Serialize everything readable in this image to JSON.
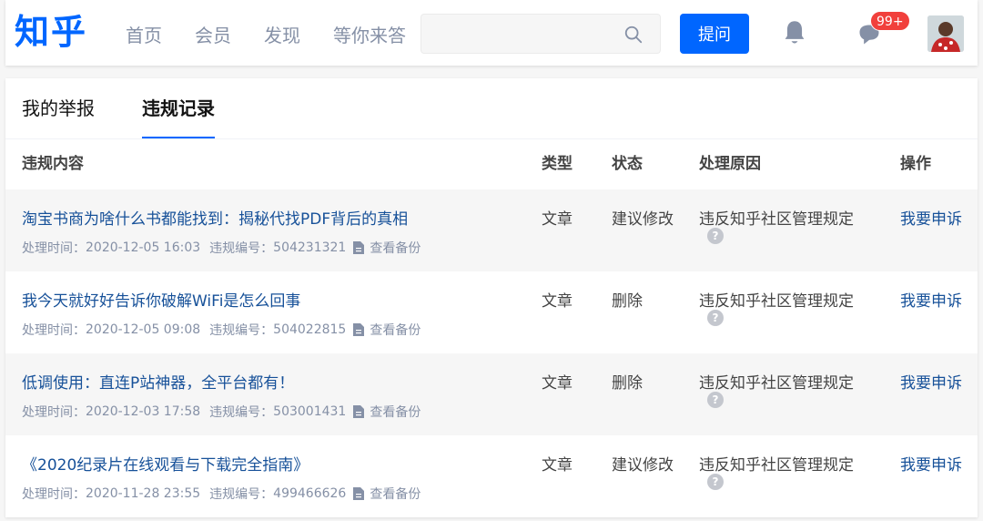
{
  "header": {
    "logo": "知乎",
    "nav": [
      "首页",
      "会员",
      "发现",
      "等你来答"
    ],
    "search_placeholder": "",
    "ask_button": "提问",
    "notification_badge": "99+"
  },
  "tabs": [
    {
      "label": "我的举报",
      "active": false
    },
    {
      "label": "违规记录",
      "active": true
    }
  ],
  "table": {
    "columns": [
      "违规内容",
      "类型",
      "状态",
      "处理原因",
      "操作"
    ],
    "meta_labels": {
      "time_prefix": "处理时间：",
      "id_prefix": "违规编号：",
      "backup": "查看备份"
    },
    "rows": [
      {
        "title": "淘宝书商为啥什么书都能找到：揭秘代找PDF背后的真相",
        "time": "2020-12-05 16:03",
        "id": "504231321",
        "type": "文章",
        "status": "建议修改",
        "reason": "违反知乎社区管理规定",
        "action": "我要申诉"
      },
      {
        "title": "我今天就好好告诉你破解WiFi是怎么回事",
        "time": "2020-12-05 09:08",
        "id": "504022815",
        "type": "文章",
        "status": "删除",
        "reason": "违反知乎社区管理规定",
        "action": "我要申诉"
      },
      {
        "title": "低调使用：直连P站神器，全平台都有！",
        "time": "2020-12-03 17:58",
        "id": "503001431",
        "type": "文章",
        "status": "删除",
        "reason": "违反知乎社区管理规定",
        "action": "我要申诉"
      },
      {
        "title": "《2020纪录片在线观看与下载完全指南》",
        "time": "2020-11-28 23:55",
        "id": "499466626",
        "type": "文章",
        "status": "建议修改",
        "reason": "违反知乎社区管理规定",
        "action": "我要申诉"
      }
    ]
  },
  "colors": {
    "brand": "#0066ff",
    "link": "#175199",
    "badge": "#f1403c",
    "muted": "#8590a6"
  }
}
